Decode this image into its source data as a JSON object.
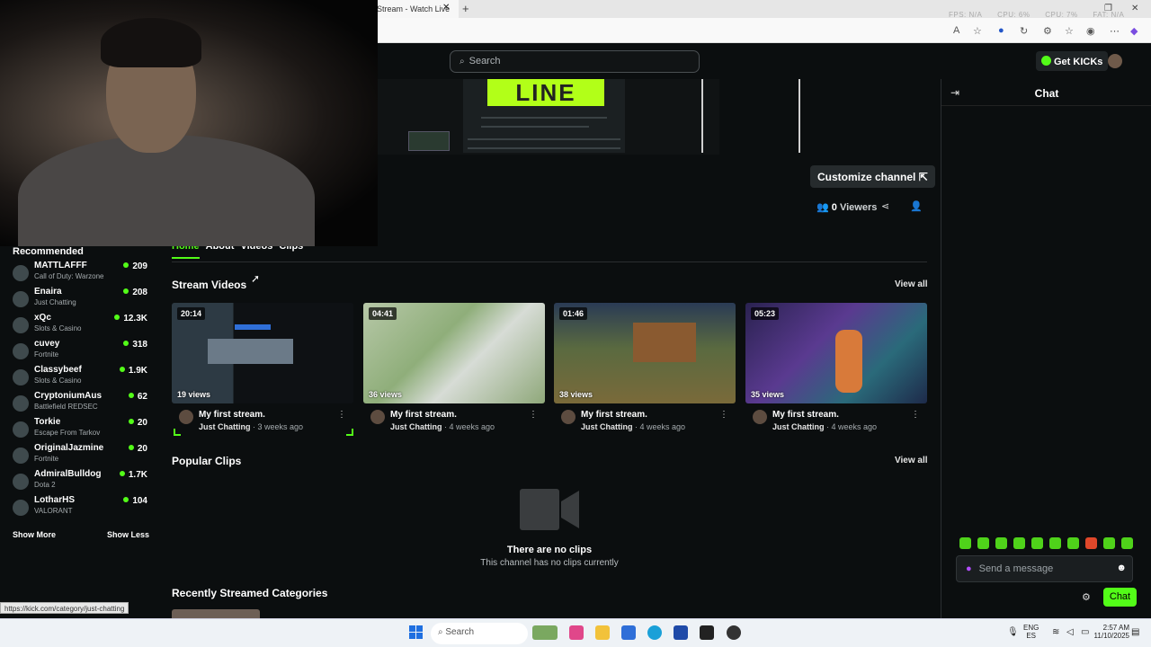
{
  "browser": {
    "tab_title": "Stream - Watch Live",
    "perf_overlay": [
      "FPS: N/A",
      "CPU: 6%",
      "CPU: 7%",
      "FAT: N/A"
    ]
  },
  "header": {
    "search_placeholder": "Search",
    "get_kicks_label": "Get KICKs"
  },
  "banner": {
    "title_text": "LINE"
  },
  "channel": {
    "customize_label": "Customize channel",
    "viewer_count": "0",
    "viewers_label": "Viewers"
  },
  "chat": {
    "title": "Chat",
    "message_placeholder": "Send a message",
    "send_label": "Chat"
  },
  "sidebar": {
    "title": "Recommended",
    "items": [
      {
        "name": "MATTLAFFF",
        "category": "Call of Duty: Warzone",
        "viewers": "209"
      },
      {
        "name": "Enaira",
        "category": "Just Chatting",
        "viewers": "208"
      },
      {
        "name": "xQc",
        "category": "Slots & Casino",
        "viewers": "12.3K"
      },
      {
        "name": "cuvey",
        "category": "Fortnite",
        "viewers": "318"
      },
      {
        "name": "Classybeef",
        "category": "Slots & Casino",
        "viewers": "1.9K"
      },
      {
        "name": "CryptoniumAus",
        "category": "Battlefield REDSEC",
        "viewers": "62"
      },
      {
        "name": "Torkie",
        "category": "Escape From Tarkov",
        "viewers": "20"
      },
      {
        "name": "OriginalJazmine",
        "category": "Fortnite",
        "viewers": "20"
      },
      {
        "name": "AdmiralBulldog",
        "category": "Dota 2",
        "viewers": "1.7K"
      },
      {
        "name": "LotharHS",
        "category": "VALORANT",
        "viewers": "104"
      }
    ],
    "show_more": "Show More",
    "show_less": "Show Less"
  },
  "tabs": [
    "Home",
    "About",
    "Videos",
    "Clips"
  ],
  "stream_videos": {
    "title": "Stream Videos",
    "view_all": "View all",
    "items": [
      {
        "duration": "20:14",
        "views": "19 views",
        "title": "My first stream.",
        "category": "Just Chatting",
        "ago": "3 weeks ago"
      },
      {
        "duration": "04:41",
        "views": "36 views",
        "title": "My first stream.",
        "category": "Just Chatting",
        "ago": "4 weeks ago"
      },
      {
        "duration": "01:46",
        "views": "38 views",
        "title": "My first stream.",
        "category": "Just Chatting",
        "ago": "4 weeks ago"
      },
      {
        "duration": "05:23",
        "views": "35 views",
        "title": "My first stream.",
        "category": "Just Chatting",
        "ago": "4 weeks ago"
      }
    ]
  },
  "popular_clips": {
    "title": "Popular Clips",
    "view_all": "View all",
    "empty_title": "There are no clips",
    "empty_subtitle": "This channel has no clips currently"
  },
  "recent_categories": {
    "title": "Recently Streamed Categories"
  },
  "status_url": "https://kick.com/category/just-chatting",
  "taskbar": {
    "search_label": "Search",
    "lang_top": "ENG",
    "lang_bottom": "ES",
    "time": "2:57 AM",
    "date": "11/10/2025"
  },
  "colors": {
    "accent": "#53fc18",
    "background": "#0b0e0f"
  }
}
